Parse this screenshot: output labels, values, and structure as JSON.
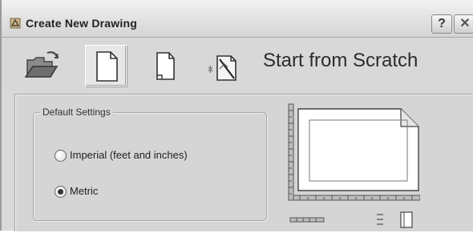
{
  "window": {
    "title": "Create New Drawing",
    "help_label": "?",
    "close_label": "✕"
  },
  "toolbar": {
    "tools": [
      {
        "name": "open-drawing",
        "icon": "folder-open-icon",
        "selected": false
      },
      {
        "name": "start-from-scratch",
        "icon": "blank-page-icon",
        "selected": true
      },
      {
        "name": "use-template",
        "icon": "template-page-icon",
        "selected": false
      },
      {
        "name": "use-wizard",
        "icon": "wizard-icon",
        "selected": false
      }
    ],
    "heading": "Start from Scratch"
  },
  "settings": {
    "legend": "Default Settings",
    "options": [
      {
        "label": "Imperial (feet and inches)",
        "checked": false
      },
      {
        "label": "Metric",
        "checked": true
      }
    ]
  },
  "colors": {
    "dialog_bg": "#d9d9d9",
    "title_text": "#222222",
    "heading_text": "#2b2b2b"
  }
}
